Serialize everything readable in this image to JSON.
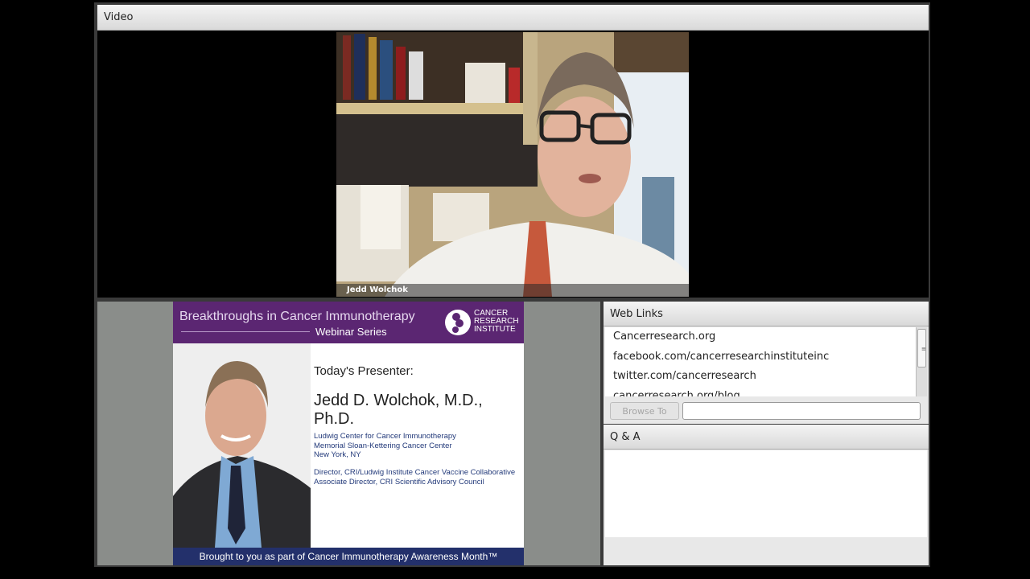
{
  "video_pod": {
    "title": "Video",
    "presenter_tag": "Jedd Wolchok"
  },
  "slide": {
    "title": "Breakthroughs in Cancer Immunotherapy",
    "subtitle": "Webinar Series",
    "logo_text": [
      "CANCER",
      "RESEARCH",
      "INSTITUTE"
    ],
    "presenter_label": "Today's Presenter:",
    "presenter_name": "Jedd D. Wolchok, M.D., Ph.D.",
    "affiliations": [
      "Ludwig Center for Cancer Immunotherapy",
      "Memorial Sloan-Kettering Cancer Center",
      "New York, NY"
    ],
    "roles": [
      "Director, CRI/Ludwig Institute Cancer Vaccine Collaborative",
      "Associate Director, CRI Scientific Advisory Council"
    ],
    "footer": "Brought to you as part of Cancer Immunotherapy Awareness Month™"
  },
  "web_links": {
    "title": "Web Links",
    "items": [
      "Cancerresearch.org",
      "facebook.com/cancerresearchinstituteinc",
      "twitter.com/cancerresearch",
      "cancerresearch.org/blog"
    ],
    "browse_label": "Browse To",
    "url_value": ""
  },
  "qa": {
    "title": "Q & A"
  },
  "colors": {
    "slide_header": "#5b2672",
    "slide_footer": "#23306b",
    "share_bg": "#8a8d8a"
  }
}
